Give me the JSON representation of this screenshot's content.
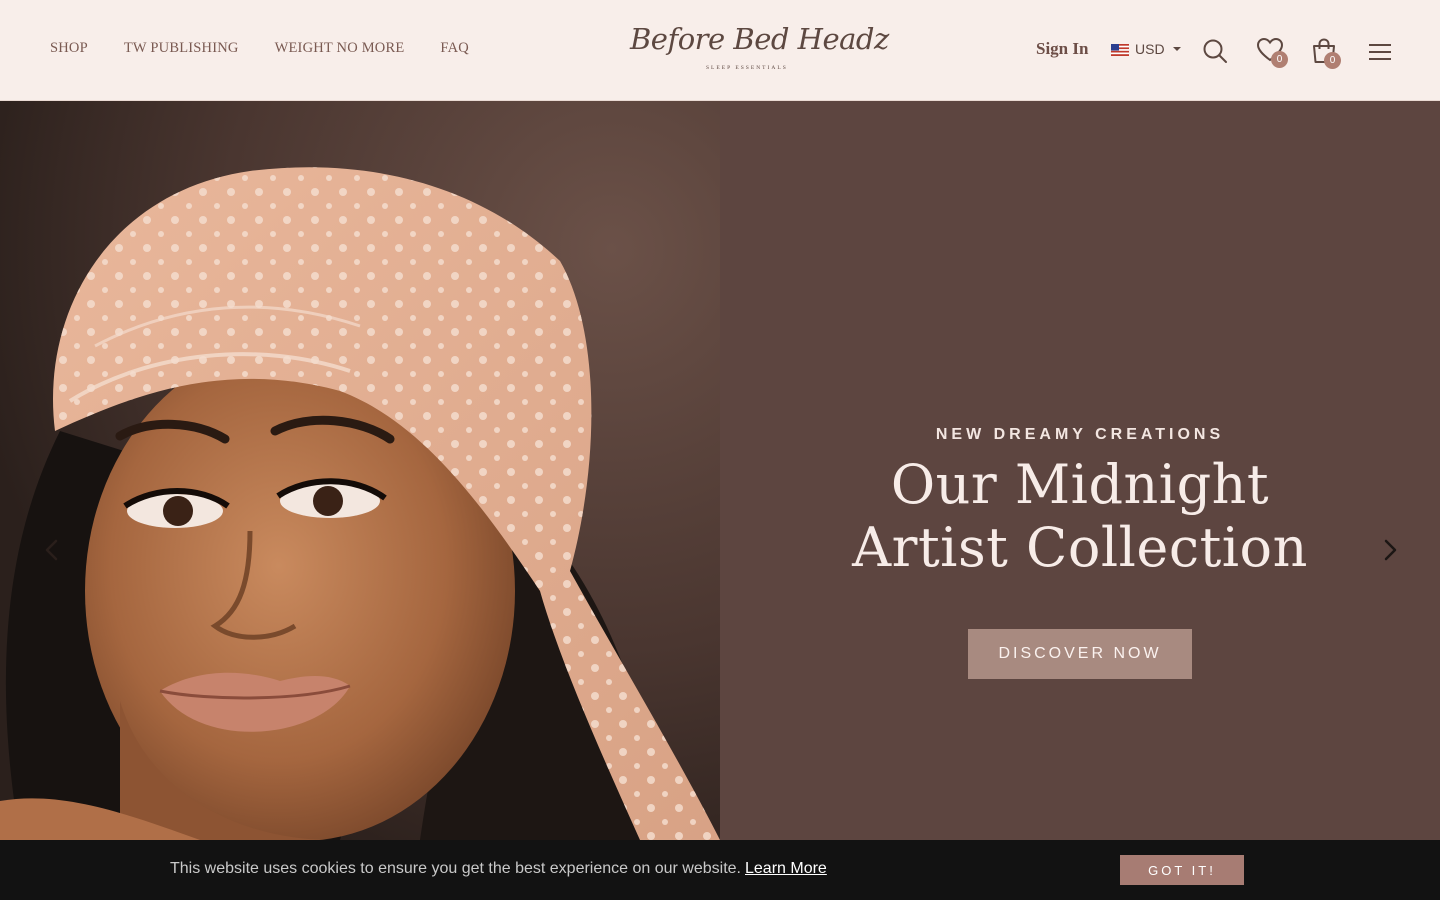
{
  "header": {
    "nav": [
      "SHOP",
      "TW PUBLISHING",
      "WEIGHT NO MORE",
      "FAQ"
    ],
    "logo": {
      "script": "Before Bed Headz",
      "tagline": "SLEEP ESSENTIALS"
    },
    "sign_in": "Sign In",
    "currency": "USD",
    "wishlist_count": "0",
    "cart_count": "0"
  },
  "hero": {
    "kicker": "NEW DREAMY CREATIONS",
    "headline_line1": "Our Midnight",
    "headline_line2": "Artist Collection",
    "cta": "DISCOVER NOW",
    "panel_color": "#5d4540"
  },
  "cookie": {
    "message": "This website uses cookies to ensure you get the best experience on our website.",
    "link": "Learn More",
    "button": "GOT IT!"
  },
  "colors": {
    "accent": "#a77c73",
    "header_bg": "#f8eeea",
    "text_brown": "#7a5a52"
  }
}
